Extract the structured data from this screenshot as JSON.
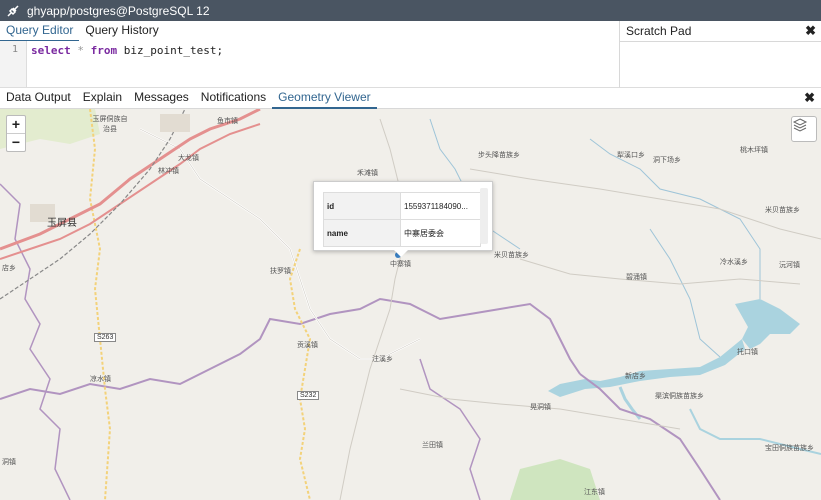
{
  "title_bar": {
    "connection": "ghyapp/postgres@PostgreSQL 12"
  },
  "editor_tabs": [
    {
      "label": "Query Editor",
      "active": true
    },
    {
      "label": "Query History",
      "active": false
    }
  ],
  "editor": {
    "line_number": "1",
    "code": {
      "kw1": "select",
      "star": "*",
      "kw2": "from",
      "table": "biz_point_test;"
    }
  },
  "scratch_pad": {
    "label": "Scratch Pad",
    "close": "✖"
  },
  "result_tabs": [
    {
      "label": "Data Output",
      "active": false
    },
    {
      "label": "Explain",
      "active": false
    },
    {
      "label": "Messages",
      "active": false
    },
    {
      "label": "Notifications",
      "active": false
    },
    {
      "label": "Geometry Viewer",
      "active": true
    }
  ],
  "result_close": "✖",
  "map": {
    "zoom_in": "+",
    "zoom_out": "−",
    "popup": {
      "rows": [
        {
          "key": "id",
          "value": "1559371184090..."
        },
        {
          "key": "name",
          "value": "中寨居委会"
        }
      ]
    },
    "place_labels": [
      "鱼市镇",
      "玉屏侗族自治县",
      "大龙镇",
      "林冲镇",
      "禾滩镇",
      "步头降苗族乡",
      "犁溪口乡",
      "洞下场乡",
      "桃木坪镇",
      "米贝苗族乡",
      "玉屏县",
      "中寨镇",
      "米贝苗族乡",
      "冷水溪乡",
      "沅河镇",
      "扶罗镇",
      "碧涌镇",
      "店乡",
      "贡溪镇",
      "注溪乡",
      "托口镇",
      "凉水镇",
      "渠滨侗族苗族乡",
      "新店乡",
      "晃洞镇",
      "兰田镇",
      "宝田侗族苗族乡",
      "江东镇",
      "洞镇"
    ],
    "road_labels": [
      "S263",
      "S232"
    ]
  },
  "colors": {
    "accent": "#326690",
    "title_bg": "#4a5562",
    "water": "#aad3df",
    "border": "#b194c0",
    "major_road": "#e4908f"
  }
}
